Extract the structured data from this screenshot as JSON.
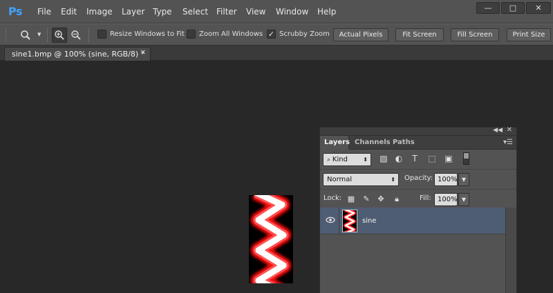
{
  "app": {
    "logo": "Ps"
  },
  "menu": [
    "File",
    "Edit",
    "Image",
    "Layer",
    "Type",
    "Select",
    "Filter",
    "View",
    "Window",
    "Help"
  ],
  "window_controls": {
    "minimize": "—",
    "maximize": "□",
    "close": "✕"
  },
  "options": {
    "zoom_tool_icon": "magnifier-icon",
    "resize_windows_label": "Resize Windows to Fit",
    "resize_windows_checked": false,
    "zoom_all_label": "Zoom All Windows",
    "zoom_all_checked": false,
    "scrubby_label": "Scrubby Zoom",
    "scrubby_checked": true,
    "actual_pixels": "Actual Pixels",
    "fit_screen": "Fit Screen",
    "fill_screen": "Fill Screen",
    "print_size": "Print Size"
  },
  "document": {
    "tab_title": "sine1.bmp @ 100% (sine, RGB/8) *"
  },
  "layers_panel": {
    "tabs": [
      "Layers",
      "Channels",
      "Paths"
    ],
    "active_tab": "Layers",
    "filter_kind": "Kind",
    "blend_mode": "Normal",
    "opacity_label": "Opacity:",
    "opacity": "100%",
    "lock_label": "Lock:",
    "fill_label": "Fill:",
    "fill": "100%",
    "layers": [
      {
        "name": "sine",
        "visible": true,
        "selected": true
      }
    ]
  },
  "colors": {
    "chrome": "#535353",
    "canvas_bg": "#282828",
    "selected_layer": "#4f5d73",
    "ps_blue": "#3fa3ff"
  }
}
